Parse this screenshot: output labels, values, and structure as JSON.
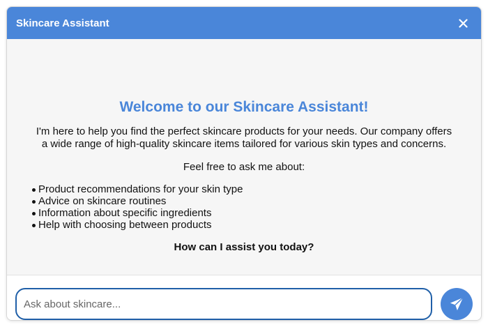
{
  "header": {
    "title": "Skincare Assistant",
    "close_icon": "close-icon"
  },
  "welcome": {
    "title": "Welcome to our Skincare Assistant!",
    "intro": "I'm here to help you find the perfect skincare products for your needs. Our company offers a wide range of high-quality skincare items tailored for various skin types and concerns.",
    "ask_prompt": "Feel free to ask me about:",
    "topics": [
      "Product recommendations for your skin type",
      "Advice on skincare routines",
      "Information about specific ingredients",
      "Help with choosing between products"
    ],
    "question": "How can I assist you today?"
  },
  "input": {
    "placeholder": "Ask about skincare...",
    "value": ""
  },
  "send_button": {
    "icon": "send-icon"
  },
  "colors": {
    "accent": "#4a86d9",
    "input_border": "#1f5fa8",
    "chat_background": "#f6f6f6"
  }
}
